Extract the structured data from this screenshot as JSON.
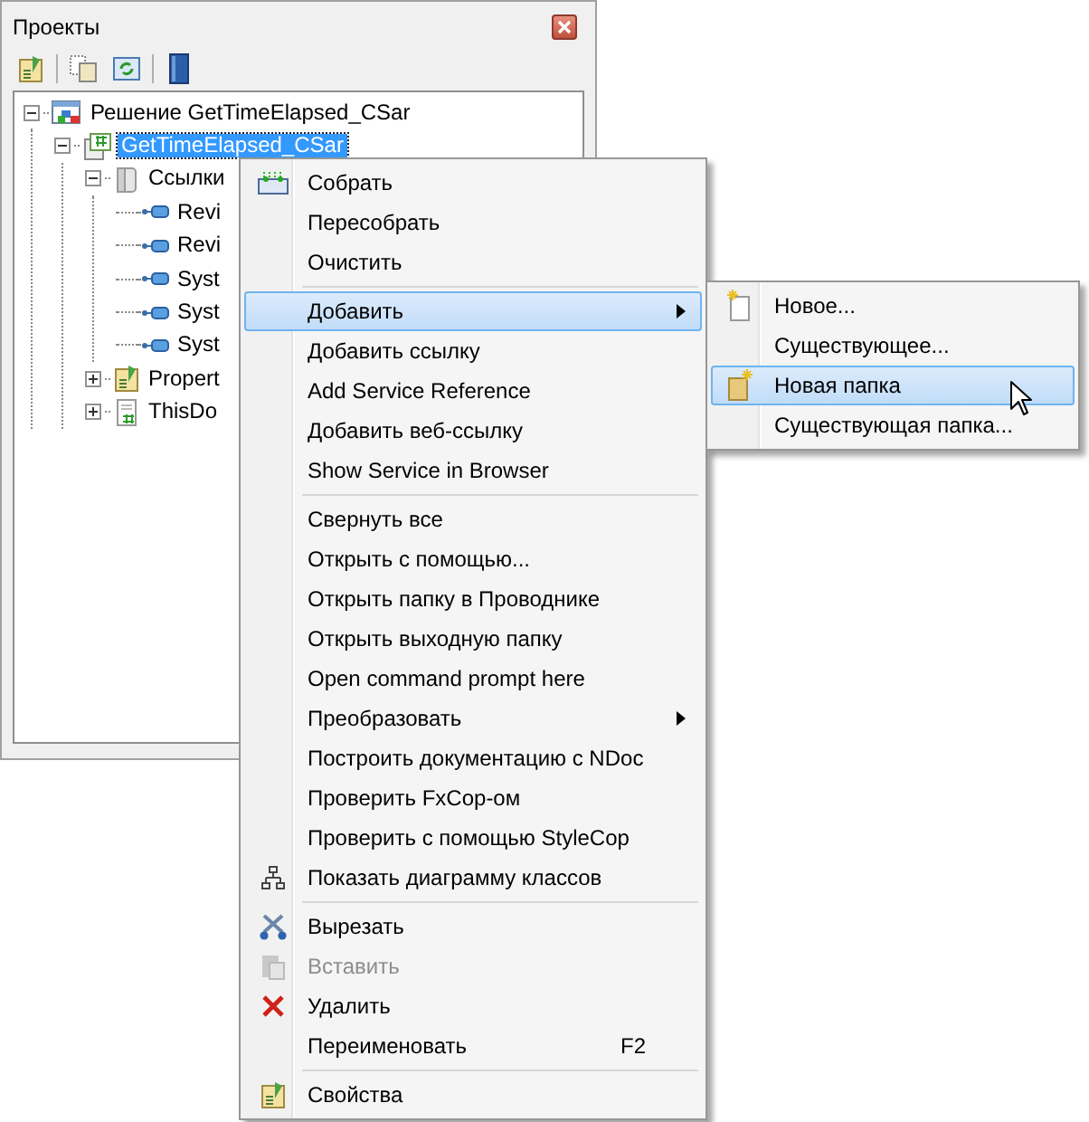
{
  "panel": {
    "title": "Проекты"
  },
  "tree": [
    {
      "label": "Решение GetTimeElapsed_CSar",
      "kind": "solution",
      "expanded": true,
      "selected": false,
      "children": [
        {
          "label": "GetTimeElapsed_CSar",
          "kind": "csproject",
          "expanded": true,
          "selected": true,
          "children": [
            {
              "label": "Ссылки",
              "kind": "references",
              "expanded": true,
              "selected": false,
              "children": [
                {
                  "label": "Revi",
                  "kind": "reference",
                  "selected": false
                },
                {
                  "label": "Revi",
                  "kind": "reference",
                  "selected": false
                },
                {
                  "label": "Syst",
                  "kind": "reference",
                  "selected": false
                },
                {
                  "label": "Syst",
                  "kind": "reference",
                  "selected": false
                },
                {
                  "label": "Syst",
                  "kind": "reference",
                  "selected": false
                }
              ]
            },
            {
              "label": "Propert",
              "kind": "properties",
              "expanded": false,
              "selected": false
            },
            {
              "label": "ThisDo",
              "kind": "csfile",
              "expanded": false,
              "selected": false
            }
          ]
        }
      ]
    }
  ],
  "context_menu": {
    "items": [
      {
        "kind": "build",
        "label": "Собрать",
        "selected": false
      },
      {
        "kind": "plain",
        "label": "Пересобрать",
        "selected": false
      },
      {
        "kind": "plain",
        "label": "Очистить",
        "selected": false
      },
      {
        "kind": "separator"
      },
      {
        "kind": "plain",
        "label": "Добавить",
        "submenu": true,
        "selected": true
      },
      {
        "kind": "plain",
        "label": "Добавить ссылку",
        "selected": false
      },
      {
        "kind": "plain",
        "label": "Add Service Reference",
        "selected": false
      },
      {
        "kind": "plain",
        "label": "Добавить веб-ссылку",
        "selected": false
      },
      {
        "kind": "plain",
        "label": "Show Service in Browser",
        "selected": false
      },
      {
        "kind": "separator"
      },
      {
        "kind": "plain",
        "label": "Свернуть все",
        "selected": false
      },
      {
        "kind": "plain",
        "label": "Открыть с помощью...",
        "selected": false
      },
      {
        "kind": "plain",
        "label": "Открыть папку в Проводнике",
        "selected": false
      },
      {
        "kind": "plain",
        "label": "Открыть выходную папку",
        "selected": false
      },
      {
        "kind": "plain",
        "label": "Open command prompt here",
        "selected": false
      },
      {
        "kind": "plain",
        "label": "Преобразовать",
        "submenu": true,
        "selected": false
      },
      {
        "kind": "plain",
        "label": "Построить документацию с NDoc",
        "selected": false
      },
      {
        "kind": "plain",
        "label": "Проверить FxCop-ом",
        "selected": false
      },
      {
        "kind": "plain",
        "label": "Проверить с помощью StyleCop",
        "selected": false
      },
      {
        "kind": "diagram",
        "label": "Показать диаграмму классов",
        "selected": false
      },
      {
        "kind": "separator"
      },
      {
        "kind": "cut",
        "label": "Вырезать",
        "selected": false
      },
      {
        "kind": "paste",
        "label": "Вставить",
        "disabled": true,
        "selected": false
      },
      {
        "kind": "delete",
        "label": "Удалить",
        "selected": false
      },
      {
        "kind": "plain",
        "label": "Переименовать",
        "shortcut": "F2",
        "selected": false
      },
      {
        "kind": "separator"
      },
      {
        "kind": "properties",
        "label": "Свойства",
        "selected": false
      }
    ]
  },
  "submenu": {
    "items": [
      {
        "kind": "newfile",
        "label": "Новое...",
        "selected": false
      },
      {
        "kind": "plain",
        "label": "Существующее...",
        "selected": false
      },
      {
        "kind": "newfolder",
        "label": "Новая папка",
        "selected": true
      },
      {
        "kind": "plain",
        "label": "Существующая папка...",
        "selected": false
      }
    ]
  }
}
